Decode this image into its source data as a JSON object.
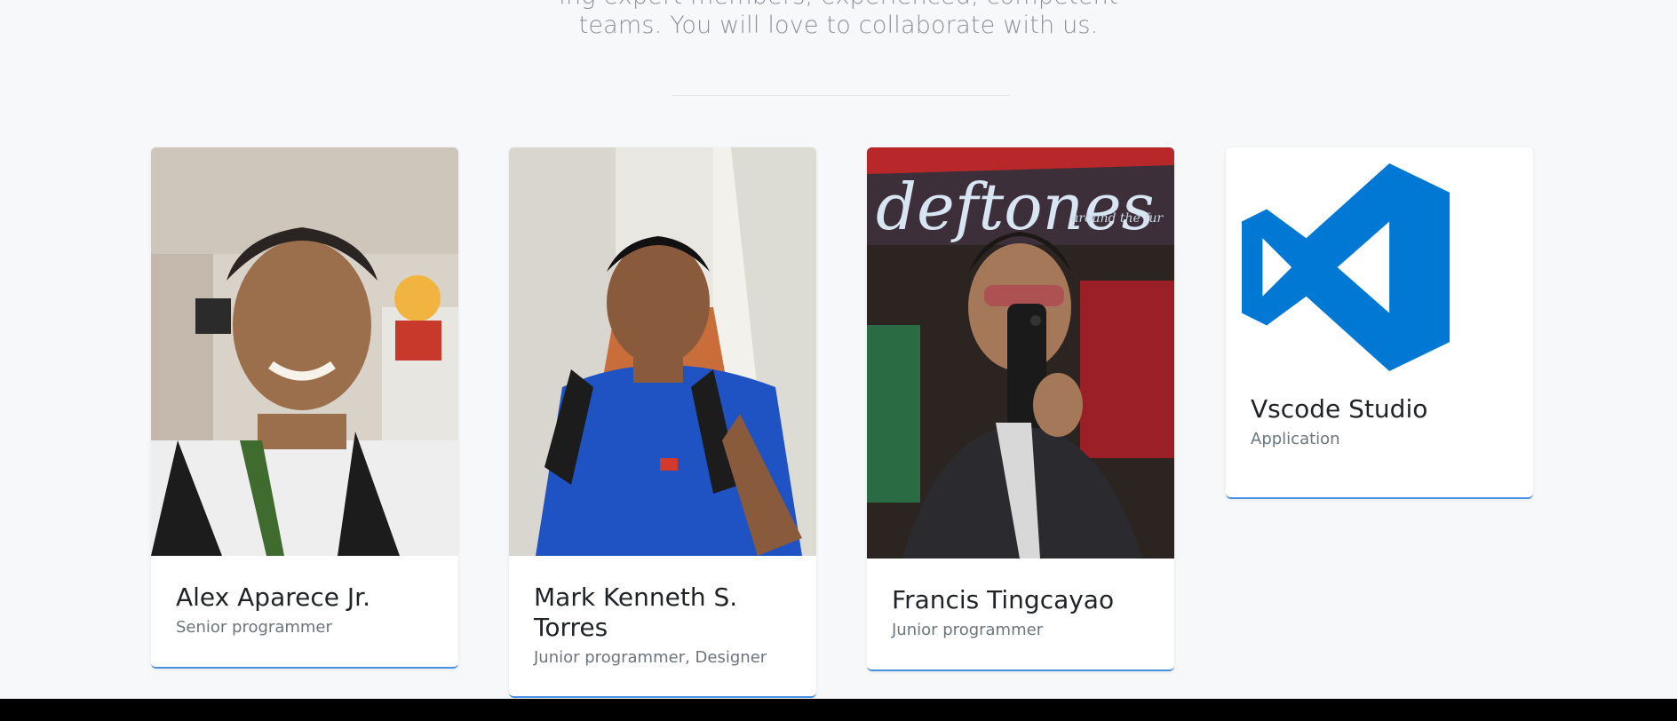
{
  "intro": {
    "line1": "ing expert members, experienced, competent",
    "line2": "teams. You will love to collaborate with us."
  },
  "team": [
    {
      "name": "Alex Aparece Jr.",
      "role": "Senior programmer"
    },
    {
      "name": "Mark Kenneth S. Torres",
      "role": "Junior programmer, Designer"
    },
    {
      "name": "Francis Tingcayao",
      "role": "Junior programmer"
    },
    {
      "name": "Vscode Studio",
      "role": "Application"
    }
  ],
  "photo_text": {
    "poster": "deftones",
    "poster_sub": "around the fur"
  },
  "colors": {
    "page_bg": "#f7f8fa",
    "card_accent": "#4a90e2",
    "vscode_blue": "#0078d4"
  }
}
